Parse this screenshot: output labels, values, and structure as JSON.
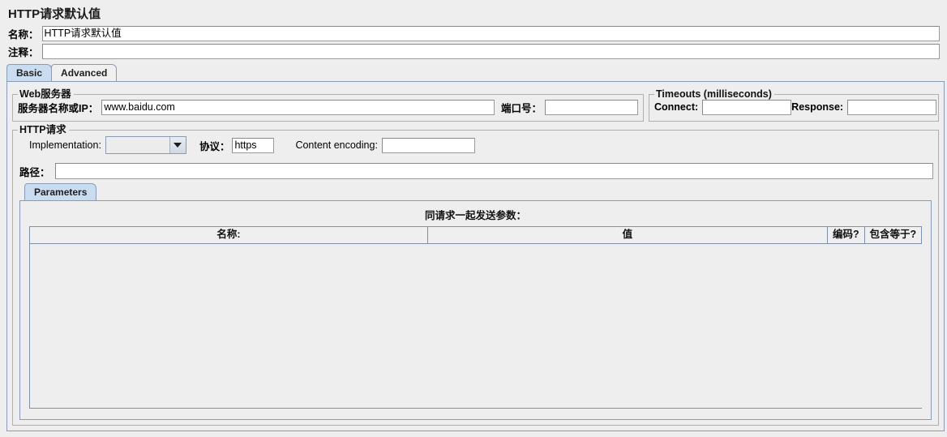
{
  "header": {
    "title": "HTTP请求默认值"
  },
  "name_field": {
    "label": "名称：",
    "value": "HTTP请求默认值",
    "placeholder": ""
  },
  "comment_field": {
    "label": "注释：",
    "value": "",
    "placeholder": ""
  },
  "tabs": [
    {
      "label": "Basic",
      "selected": true
    },
    {
      "label": "Advanced",
      "selected": false
    }
  ],
  "web_server": {
    "group_label": "Web服务器",
    "server_label": "服务器名称或IP：",
    "server_value": "www.baidu.com",
    "port_label": "端口号：",
    "port_value": ""
  },
  "timeouts": {
    "group_label": "Timeouts (milliseconds)",
    "connect_label": "Connect:",
    "connect_value": "",
    "response_label": "Response:",
    "response_value": ""
  },
  "http_request": {
    "group_label": "HTTP请求",
    "implementation_label": "Implementation:",
    "implementation_value": "",
    "protocol_label": "协议：",
    "protocol_value": "https",
    "content_encoding_label": "Content encoding:",
    "content_encoding_value": "",
    "path_label": "路径：",
    "path_value": ""
  },
  "parameters": {
    "tabs": [
      {
        "label": "Parameters",
        "selected": true
      }
    ],
    "caption": "同请求一起发送参数：",
    "table": {
      "columns": [
        "名称:",
        "值",
        "编码?",
        "包含等于?"
      ],
      "rows": []
    }
  },
  "icons": {
    "combo_arrow": "chevron-down-icon"
  },
  "colors": {
    "background": "#eeeeee",
    "tab_selected": "#c9dcf0",
    "panel_border": "#8a9cb5",
    "group_border": "#b0b0b0",
    "field_background": "#ffffff",
    "table_border": "#7e90a8"
  }
}
